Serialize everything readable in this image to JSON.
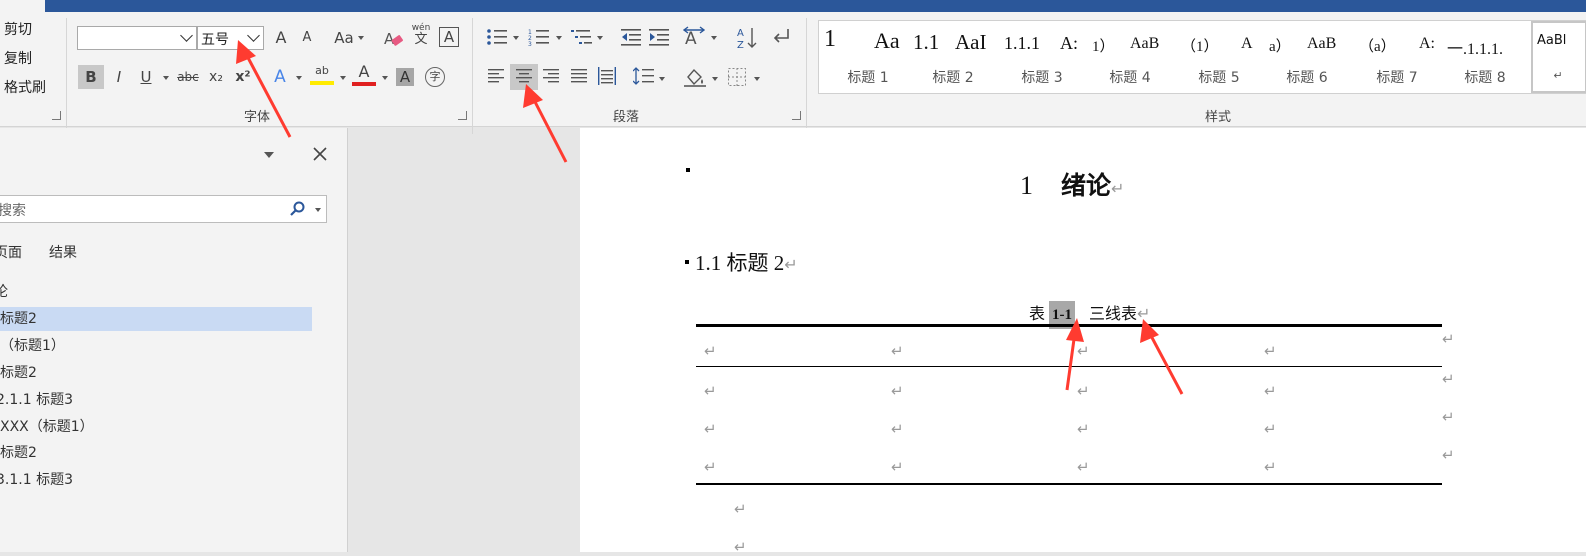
{
  "clipboard": {
    "cut": "剪切",
    "copy": "复制",
    "format_painter": "格式刷"
  },
  "font": {
    "group_label": "字体",
    "font_name_value": "",
    "font_size_value": "五号",
    "buttons": {
      "bold": "B",
      "italic": "I",
      "underline": "U",
      "strikethrough": "abc",
      "subscript": "x₂",
      "superscript": "x²",
      "grow_font": "A",
      "shrink_font": "A",
      "change_case": "Aa",
      "phonetic": "wén",
      "phonetic_char": "文",
      "char_border": "A",
      "text_effects": "A",
      "highlight": "ab",
      "font_color": "A",
      "char_shading": "A",
      "enclose": "字"
    }
  },
  "paragraph": {
    "group_label": "段落"
  },
  "styles": {
    "group_label": "样式",
    "items": [
      {
        "preview_1": "1",
        "preview_2": "Aa",
        "name": "标题 1"
      },
      {
        "preview_1": "1.1",
        "preview_2": "AaI",
        "name": "标题 2"
      },
      {
        "preview_1": "1.1.1",
        "preview_2": "A:",
        "name": "标题 3"
      },
      {
        "preview_1": "1）",
        "preview_2": "AaB",
        "name": "标题 4"
      },
      {
        "preview_1": "（1）",
        "preview_2": "A",
        "name": "标题 5"
      },
      {
        "preview_1": "a）",
        "preview_2": "AaB",
        "name": "标题 6"
      },
      {
        "preview_1": "（a）",
        "preview_2": "A:",
        "name": "标题 7"
      },
      {
        "preview_1": "一.1.1.1.",
        "preview_2": "",
        "name": "标题 8"
      },
      {
        "preview_1": "AaBl",
        "preview_2": "",
        "name": "↵"
      }
    ]
  },
  "nav_pane": {
    "search_placeholder": "搜索",
    "tabs": [
      "页面",
      "结果"
    ],
    "items": [
      "论",
      "标题2",
      "（标题1）",
      "标题2",
      "2.1.1 标题3",
      "XXX（标题1）",
      "标题2",
      "3.1.1 标题3"
    ]
  },
  "document": {
    "heading1": {
      "number": "1",
      "text": "绪论"
    },
    "heading2": "1.1 标题 2",
    "caption": {
      "prefix": "表",
      "field": "1-1",
      "title": "三线表"
    },
    "para_mark": "↵",
    "row_end_mark": "↵"
  },
  "colors": {
    "title_bar": "#2b579a",
    "arrow": "#ff3b30",
    "highlight_yellow": "#ffeb00",
    "font_color_red": "#e02020",
    "nav_selected": "#c9daf3"
  }
}
